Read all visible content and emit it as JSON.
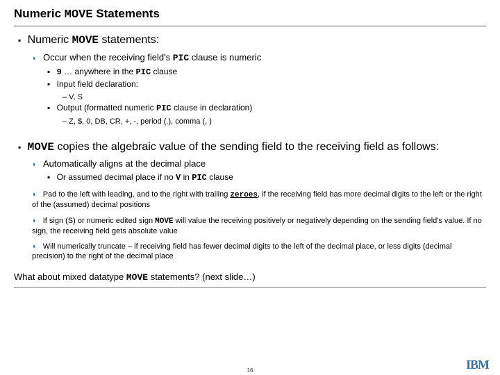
{
  "title_pre": "Numeric ",
  "title_mono": "MOVE",
  "title_post": " Statements",
  "sec1": {
    "pre": "Numeric ",
    "mono": "MOVE",
    "post": " statements:",
    "sub1_pre": "Occur when the receiving field's ",
    "sub1_mono": "PIC",
    "sub1_post": " clause is numeric",
    "s1a_mono": "9",
    "s1a_mid": " … anywhere  in the ",
    "s1a_mono2": "PIC",
    "s1a_post": " clause",
    "s1b": "Input field declaration:",
    "s1b_detail": "– V, S",
    "s1c_pre": "Output (formatted numeric ",
    "s1c_mono": "PIC",
    "s1c_post": " clause in declaration)",
    "s1c_detail": "– Z, $, 0, DB, CR, +, -, period (.),  comma (, )"
  },
  "sec2": {
    "mono": "MOVE",
    "post": " copies the algebraic value of the sending field to the receiving field as follows:",
    "b1": "Automatically aligns at the decimal place",
    "b1a_pre": "Or assumed decimal place if no ",
    "b1a_mono": "V",
    "b1a_mid": " in ",
    "b1a_mono2": "PIC",
    "b1a_post": " clause",
    "b2_pre": "Pad to the left with leading, and to the right with trailing ",
    "b2_u": "zeroes",
    "b2_post": ", if the receiving field has more decimal digits to the left or the right of the (assumed) decimal positions",
    "b3_pre": "If sign (S) or numeric edited sign ",
    "b3_mono": "MOVE",
    "b3_post": " will value the receiving positively or negatively depending on the sending field's value.  If no sign, the receiving field gets absolute value",
    "b4": "Will numerically truncate – if receiving field has fewer decimal digits to the left of the decimal place, or less digits (decimal precision) to the right of the decimal place"
  },
  "footer_q_pre": "What about mixed datatype ",
  "footer_q_mono": "MOVE",
  "footer_q_post": " statements?  (next slide…)",
  "page": "16",
  "logo": "IBM"
}
